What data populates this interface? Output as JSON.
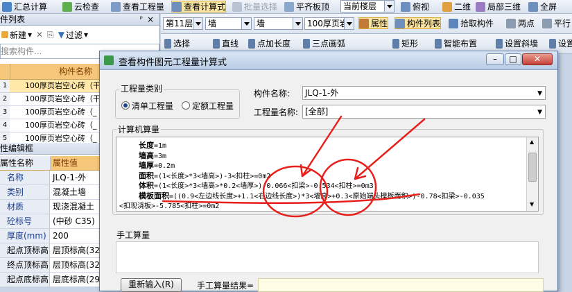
{
  "toolbar": {
    "items": [
      "汇总计算",
      "云检查",
      "查看工程量",
      "查看计算式",
      "批量选择",
      "平齐板顶"
    ],
    "floor_scope": "当前楼层",
    "view_items": [
      "俯视",
      "二维",
      "局部三维",
      "全屏"
    ]
  },
  "toolbar2": {
    "floor": "第11层",
    "type1": "墙",
    "type2": "墙",
    "component": "100厚页岩",
    "property_btn": "属性",
    "component_list_btn": "构件列表",
    "pick_btn": "拾取构件",
    "two_points": "两点",
    "parallel": "平行"
  },
  "toolbar3": {
    "items": [
      "选择",
      "直线",
      "点加长度",
      "三点画弧",
      "矩形",
      "智能布置",
      "设置斜墙",
      "设置"
    ]
  },
  "left_panel": {
    "list_title": "件列表",
    "new_btn": "新建",
    "filter_btn": "过滤",
    "search_placeholder": "搜索构件...",
    "col_header": "构件名称",
    "rows": [
      {
        "num": "1",
        "name": "100厚页岩空心砖（干"
      },
      {
        "num": "2",
        "name": "100厚页岩空心砖（干"
      },
      {
        "num": "3",
        "name": "100厚页岩空心砖（_"
      },
      {
        "num": "4",
        "name": "100厚页岩空心砖（_"
      },
      {
        "num": "5",
        "name": "100厚页岩空心砖（_"
      }
    ],
    "prop_title": "性编辑框",
    "prop_header_name": "属性名称",
    "prop_header_value": "属性值",
    "props": [
      {
        "name": "名称",
        "value": "JLQ-1-外"
      },
      {
        "name": "类别",
        "value": "混凝土墙"
      },
      {
        "name": "材质",
        "value": "现浇混凝土"
      },
      {
        "name": "砼标号",
        "value": "(中砂 C35)"
      },
      {
        "name": "厚度(mm)",
        "value": "200"
      },
      {
        "name": "起点顶标高",
        "value": "层顶标高(32"
      },
      {
        "name": "终点顶标高",
        "value": "层顶标高(32"
      },
      {
        "name": "起点底标高",
        "value": "层底标高(29"
      }
    ]
  },
  "dialog": {
    "title": "查看构件图元工程量计算式",
    "qty_type_label": "工程量类别",
    "radio_list": "清单工程量",
    "radio_quota": "定额工程量",
    "component_name_label": "构件名称:",
    "component_name_value": "JLQ-1-外",
    "qty_name_label": "工程量名称:",
    "qty_name_value": "[全部]",
    "computer_calc_label": "计算机算量",
    "calc_lines": [
      {
        "name": "长度",
        "expr": "=1m"
      },
      {
        "name": "墙高",
        "expr": "=3m"
      },
      {
        "name": "墙厚",
        "expr": "=0.2m"
      },
      {
        "name": "面积",
        "expr": "=(1<长度>*3<墙高>)-3<扣柱>=0m2"
      },
      {
        "name": "体积",
        "expr": "=(1<长度>*3<墙高>*0.2<墙厚>)-0.066<扣梁>-0.534<扣柱>=0m3"
      },
      {
        "name": "模板面积",
        "expr": "=((0.9<左边线长度>+1.1<右边线长度>)*3<墙高>+0.3<原始端头模板面积>)-0.78<扣梁>-0.035"
      },
      {
        "name": "",
        "expr": "<扣现浇板>-5.785<扣柱>=0m2"
      }
    ],
    "manual_calc_label": "手工算量",
    "reinput_btn": "重新输入(R)",
    "manual_result_label": "手工算量结果="
  },
  "colors": {
    "annotation_red": "#e8201c",
    "header_orange": "#f6c77a",
    "selected_row": "#ffe8a8"
  }
}
